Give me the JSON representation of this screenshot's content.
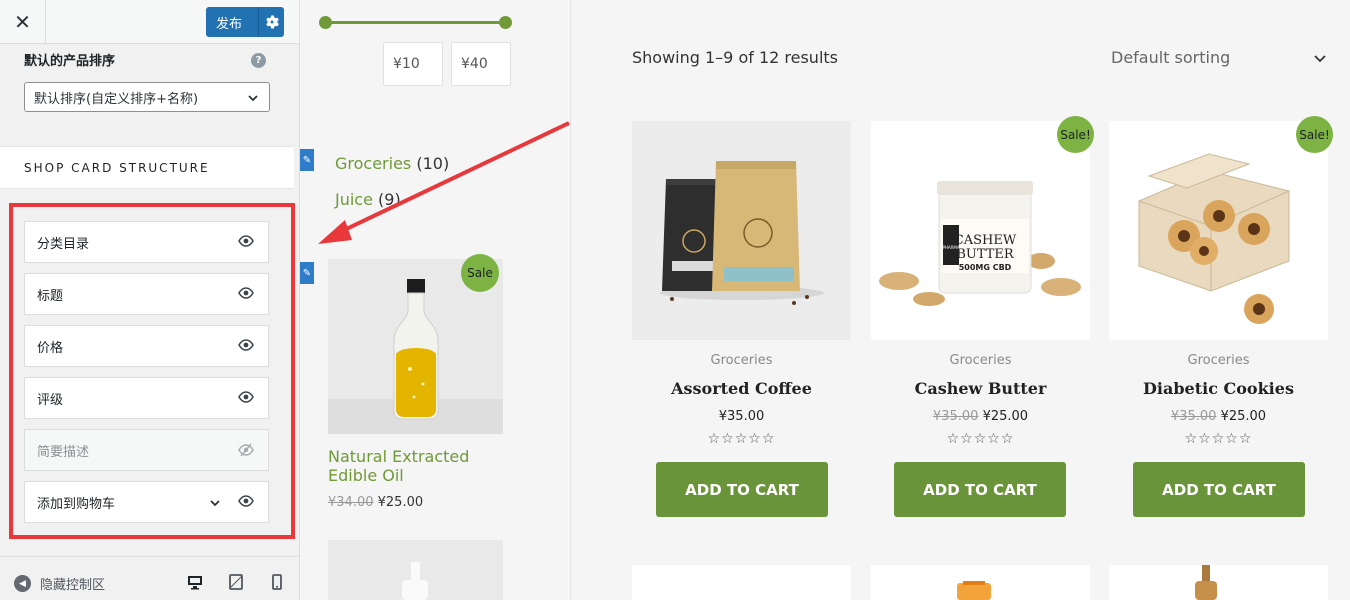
{
  "sidebar": {
    "close_icon": "close-icon",
    "publish_label": "发布",
    "publish_settings_icon": "gear-icon",
    "sort_label": "默认的产品排序",
    "help_icon": "?",
    "sort_value": "默认排序(自定义排序+名称)",
    "card_structure_title": "SHOP CARD STRUCTURE",
    "items": [
      {
        "label": "分类目录",
        "visible": true
      },
      {
        "label": "标题",
        "visible": true
      },
      {
        "label": "价格",
        "visible": true
      },
      {
        "label": "评级",
        "visible": true
      },
      {
        "label": "简要描述",
        "visible": false
      },
      {
        "label": "添加到购物车",
        "visible": true
      }
    ],
    "hide_controls_label": "隐藏控制区",
    "devices": [
      "desktop-icon",
      "tablet-icon",
      "mobile-icon"
    ],
    "highlight_color": "#e8383b"
  },
  "filter": {
    "price_min": "¥10",
    "price_max": "¥40",
    "categories": [
      {
        "name": "Groceries",
        "count": "(10)"
      },
      {
        "name": "Juice",
        "count": "(9)"
      }
    ]
  },
  "side_product": {
    "badge": "Sale",
    "title": "Natural Extracted Edible Oil",
    "old_price": "¥34.00",
    "price": "¥25.00"
  },
  "shop": {
    "results_text": "Showing 1–9 of 12 results",
    "sorting": "Default sorting",
    "products": [
      {
        "category": "Groceries",
        "title": "Assorted Coffee",
        "old_price": "",
        "price": "¥35.00",
        "sale": "",
        "stars": "☆☆☆☆☆",
        "button": "ADD TO CART"
      },
      {
        "category": "Groceries",
        "title": "Cashew Butter",
        "old_price": "¥35.00",
        "price": "¥25.00",
        "sale": "Sale!",
        "stars": "☆☆☆☆☆",
        "button": "ADD TO CART"
      },
      {
        "category": "Groceries",
        "title": "Diabetic Cookies",
        "old_price": "¥35.00",
        "price": "¥25.00",
        "sale": "Sale!",
        "stars": "☆☆☆☆☆",
        "button": "ADD TO CART"
      }
    ],
    "accent_color": "#6a9439",
    "badge_color": "#7cb342"
  },
  "product_images": {
    "jar_label_line1": "CASHEW",
    "jar_label_line2": "BUTTER",
    "jar_label_line3": "500MG CBD",
    "jar_brand": "PHARMA"
  }
}
